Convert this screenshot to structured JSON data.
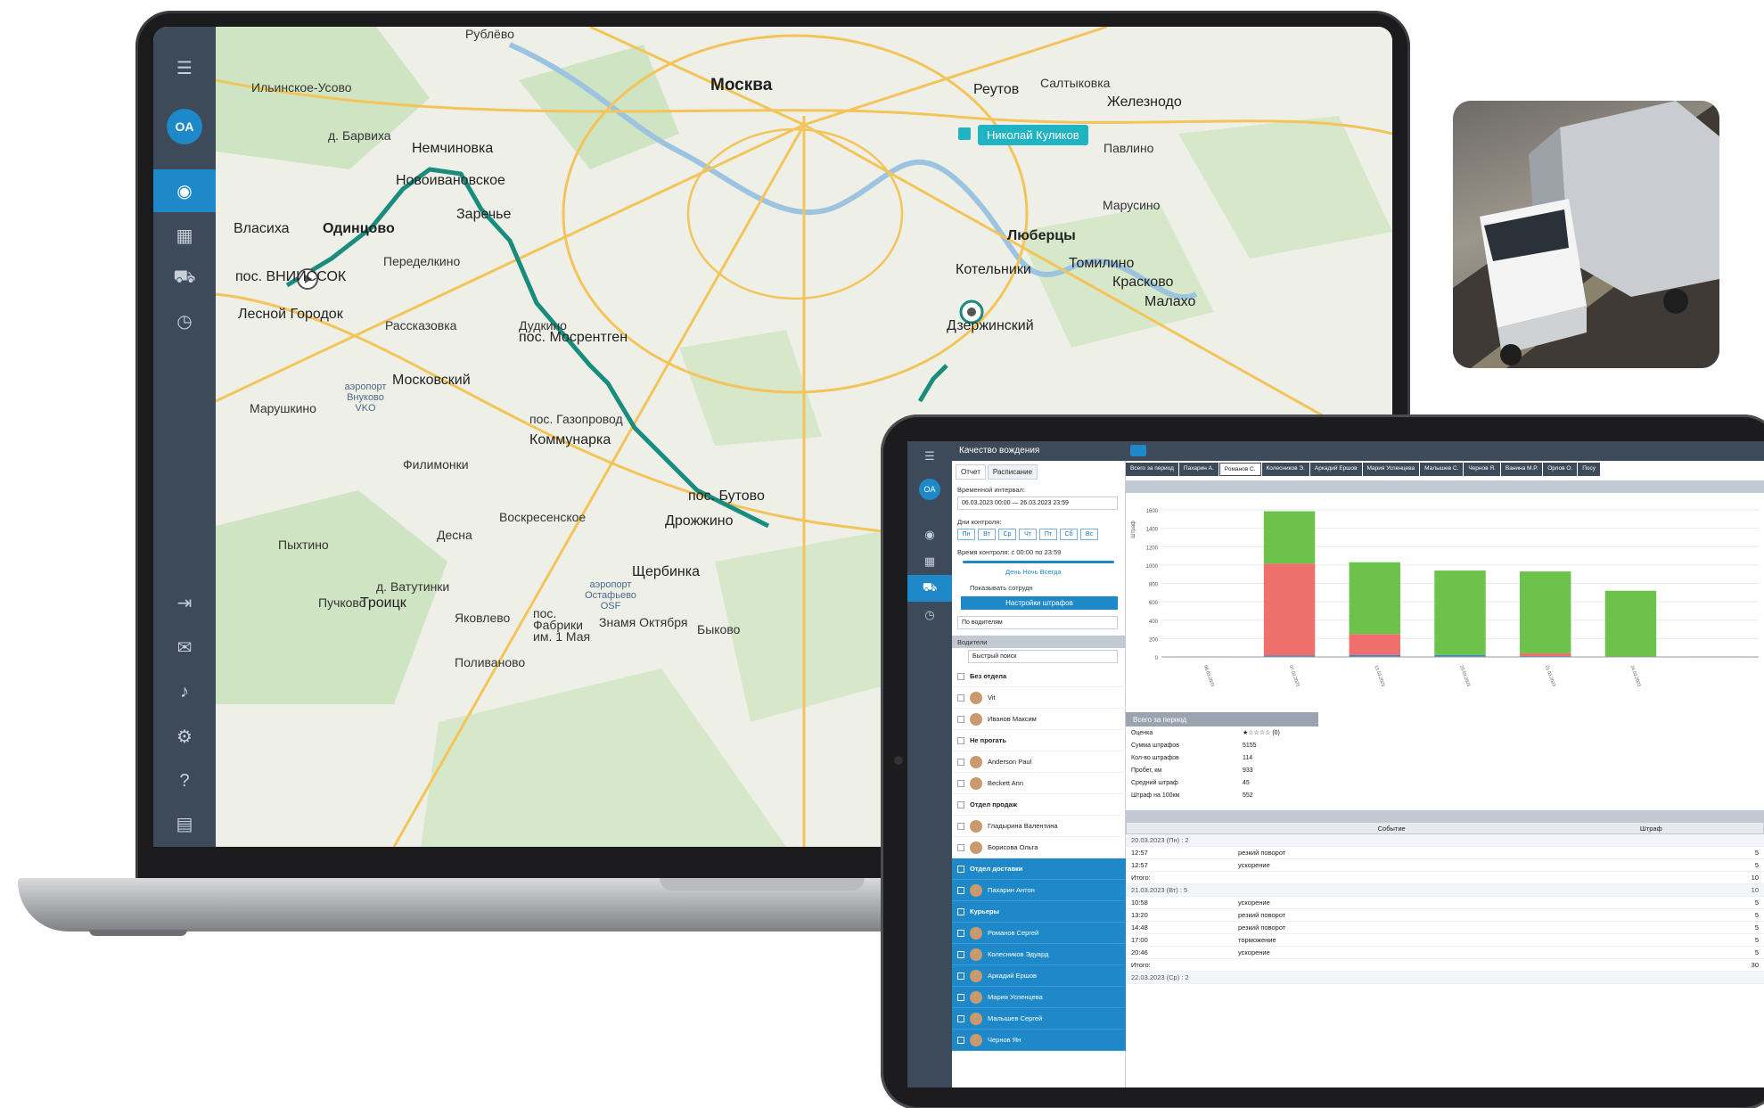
{
  "laptop": {
    "sidebar": {
      "avatar": "OA",
      "icons": [
        "menu-icon",
        "globe-icon",
        "report-icon",
        "car-icon",
        "clock-icon",
        "exit-icon",
        "message-icon",
        "bell-icon",
        "gear-icon",
        "help-icon",
        "chat-icon"
      ]
    },
    "map": {
      "driver_tag": "Николай Куликов",
      "labels": {
        "moscow": "Москва",
        "reutov": "Реутов",
        "zheleznodor": "Железнодо",
        "lyubertsy": "Люберцы",
        "kotelniki": "Котельники",
        "tomilino": "Томилино",
        "krasnovo": "Красково",
        "malakh": "Малахо",
        "dzerzh": "Дзержинский",
        "odintsovo": "Одинцово",
        "vlasikha": "Власиха",
        "vnukovo": "пос. ВНИИССОК",
        "lesnoy": "Лесной Городок",
        "nemchinovka": "Немчиновка",
        "novoivan": "Новоивановское",
        "zarechye": "Заречье",
        "moskovsky": "Московский",
        "kommunarka": "Коммунарка",
        "gazoprovod": "пос. Газопровод",
        "mosrentgen": "пос. Мосрентген",
        "butovo": "пос. Бутово",
        "drozhzhino": "Дрожжино",
        "shcherbinka": "Щербинка",
        "troitsk": "Троицк",
        "vatutinki": "д. Ватутинки",
        "ilinskoe": "Ильинское-Усово",
        "barvikha": "д. Барвиха",
        "peredelkino": "Переделкино",
        "rasskazovka": "Рассказовка",
        "filimonki": "Филимонки",
        "voskresenskoe": "Воскресенское",
        "desna": "Десна",
        "pykhtino": "Пыхтино",
        "puchkovo": "Пучково",
        "yakovlevo": "Яковлево",
        "fabriki": "пос. Фабрики им. 1 Мая",
        "znamya": "Знамя Октября",
        "bykovo": "Быково",
        "polivanovo": "Поливаново",
        "marushkino": "Марушкино",
        "saltykovka": "Салтыковка",
        "pavlino": "Павлино",
        "marusino": "Марусино",
        "rublevo": "Рублёво",
        "vnukovo_air": "аэропорт Внуково VKO",
        "ostafyevo_air": "аэропорт Остафьево OSF",
        "dudkino": "Дудкино"
      }
    }
  },
  "tablet": {
    "header_title": "Качество вождения",
    "tabs": [
      "Отчет",
      "Расписание"
    ],
    "time_interval_label": "Временной интервал:",
    "time_interval_value": "06.03.2023 00:00 — 26.03.2023 23:59",
    "days_label": "Дни контроля:",
    "days": [
      "Пн",
      "Вт",
      "Ср",
      "Чт",
      "Пт",
      "Сб",
      "Вс"
    ],
    "time_control_label": "Время контроля: с 00:00 по 23:59",
    "day_night": "День  Ночь  Всегда",
    "show_employees": "Показывать сотрудн",
    "penalty_button": "Настройки штрафов",
    "group_select": "По водителям",
    "drivers_section": "Водители",
    "quick_search": "Быстрый поиск",
    "drivers": [
      {
        "name": "Без отдела",
        "group": true,
        "sel": false
      },
      {
        "name": "Vit",
        "group": false,
        "sel": false
      },
      {
        "name": "Иванов Максим",
        "group": false,
        "sel": false
      },
      {
        "name": "Не прогать",
        "group": true,
        "sel": false
      },
      {
        "name": "Anderson Paul",
        "group": false,
        "sel": false
      },
      {
        "name": "Beckett Ann",
        "group": false,
        "sel": false
      },
      {
        "name": "Отдел продаж",
        "group": true,
        "sel": false
      },
      {
        "name": "Гладырина Валентина",
        "group": false,
        "sel": false
      },
      {
        "name": "Борисова Ольга",
        "group": false,
        "sel": false
      },
      {
        "name": "Отдел доставки",
        "group": true,
        "sel": true
      },
      {
        "name": "Пахарин Антон",
        "group": false,
        "sel": true
      },
      {
        "name": "Курьеры",
        "group": true,
        "sel": true
      },
      {
        "name": "Романов Сергей",
        "group": false,
        "sel": true
      },
      {
        "name": "Колесников Эдуард",
        "group": false,
        "sel": true
      },
      {
        "name": "Аркадий Ершов",
        "group": false,
        "sel": true
      },
      {
        "name": "Мария Успенцева",
        "group": false,
        "sel": true
      },
      {
        "name": "Малышев Сергей",
        "group": false,
        "sel": true
      },
      {
        "name": "Чернов Ян",
        "group": false,
        "sel": true
      }
    ],
    "report_tabs": [
      "Всего за период",
      "Пахарин А.",
      "Романов С.",
      "Колесников Э.",
      "Аркадий Ершов",
      "Мария Успенцева",
      "Малышев С.",
      "Чернов Я.",
      "Ванина М.Р.",
      "Орлов О.",
      "Посу"
    ],
    "summary": {
      "title": "Всего за период",
      "rows": [
        [
          "Оценка",
          "★☆☆☆☆ (0)"
        ],
        [
          "Сумма штрафов",
          "5155"
        ],
        [
          "Кол-во штрафов",
          "114"
        ],
        [
          "Пробег, км",
          "933"
        ],
        [
          "Средний штраф",
          "45"
        ],
        [
          "Штраф на 100км",
          "552"
        ]
      ]
    },
    "events": {
      "headers": [
        "",
        "Событие",
        "Штраф"
      ],
      "rows": [
        {
          "type": "date",
          "c1": "20.03.2023 (Пн) : 2",
          "c2": "",
          "c3": ""
        },
        {
          "type": "row",
          "c1": "12:57",
          "c2": "резкий поворот",
          "c3": "5"
        },
        {
          "type": "row",
          "c1": "12:57",
          "c2": "ускорение",
          "c3": "5"
        },
        {
          "type": "row",
          "c1": "Итого:",
          "c2": "",
          "c3": "10"
        },
        {
          "type": "date",
          "c1": "21.03.2023 (Вт) : 5",
          "c2": "",
          "c3": "10"
        },
        {
          "type": "row",
          "c1": "10:58",
          "c2": "ускорение",
          "c3": "5"
        },
        {
          "type": "row",
          "c1": "13:20",
          "c2": "резкий поворот",
          "c3": "5"
        },
        {
          "type": "row",
          "c1": "14:48",
          "c2": "резкий поворот",
          "c3": "5"
        },
        {
          "type": "row",
          "c1": "17:00",
          "c2": "торможение",
          "c3": "5"
        },
        {
          "type": "row",
          "c1": "20:46",
          "c2": "ускорение",
          "c3": "5"
        },
        {
          "type": "row",
          "c1": "Итого:",
          "c2": "",
          "c3": "30"
        },
        {
          "type": "date",
          "c1": "22.03.2023 (Ср) : 2",
          "c2": "",
          "c3": ""
        }
      ]
    }
  },
  "chart_data": {
    "type": "bar",
    "categories": [
      "06.03.2023",
      "07.03.2023",
      "13.03.2023",
      "20.03.2023",
      "21.03.2023",
      "24.03.2023",
      ""
    ],
    "series": [
      {
        "name": "",
        "color": "#ef6f6c",
        "values": [
          0,
          1000,
          230,
          0,
          30,
          0,
          0
        ]
      },
      {
        "name": "",
        "color": "#6cc24a",
        "values": [
          5,
          570,
          780,
          920,
          890,
          720,
          5
        ]
      },
      {
        "name": "",
        "color": "#2a8ad4",
        "values": [
          0,
          15,
          20,
          20,
          10,
          0,
          0
        ]
      }
    ],
    "yticks": [
      "0",
      "200",
      "400",
      "600",
      "800",
      "1000",
      "1200",
      "1400",
      "1600"
    ],
    "ylabel": "Штраф",
    "ylim": [
      0,
      1600
    ]
  },
  "colors": {
    "accent": "#1e88c9",
    "sidebar": "#3c4a5a",
    "route": "#1a8c7e"
  }
}
